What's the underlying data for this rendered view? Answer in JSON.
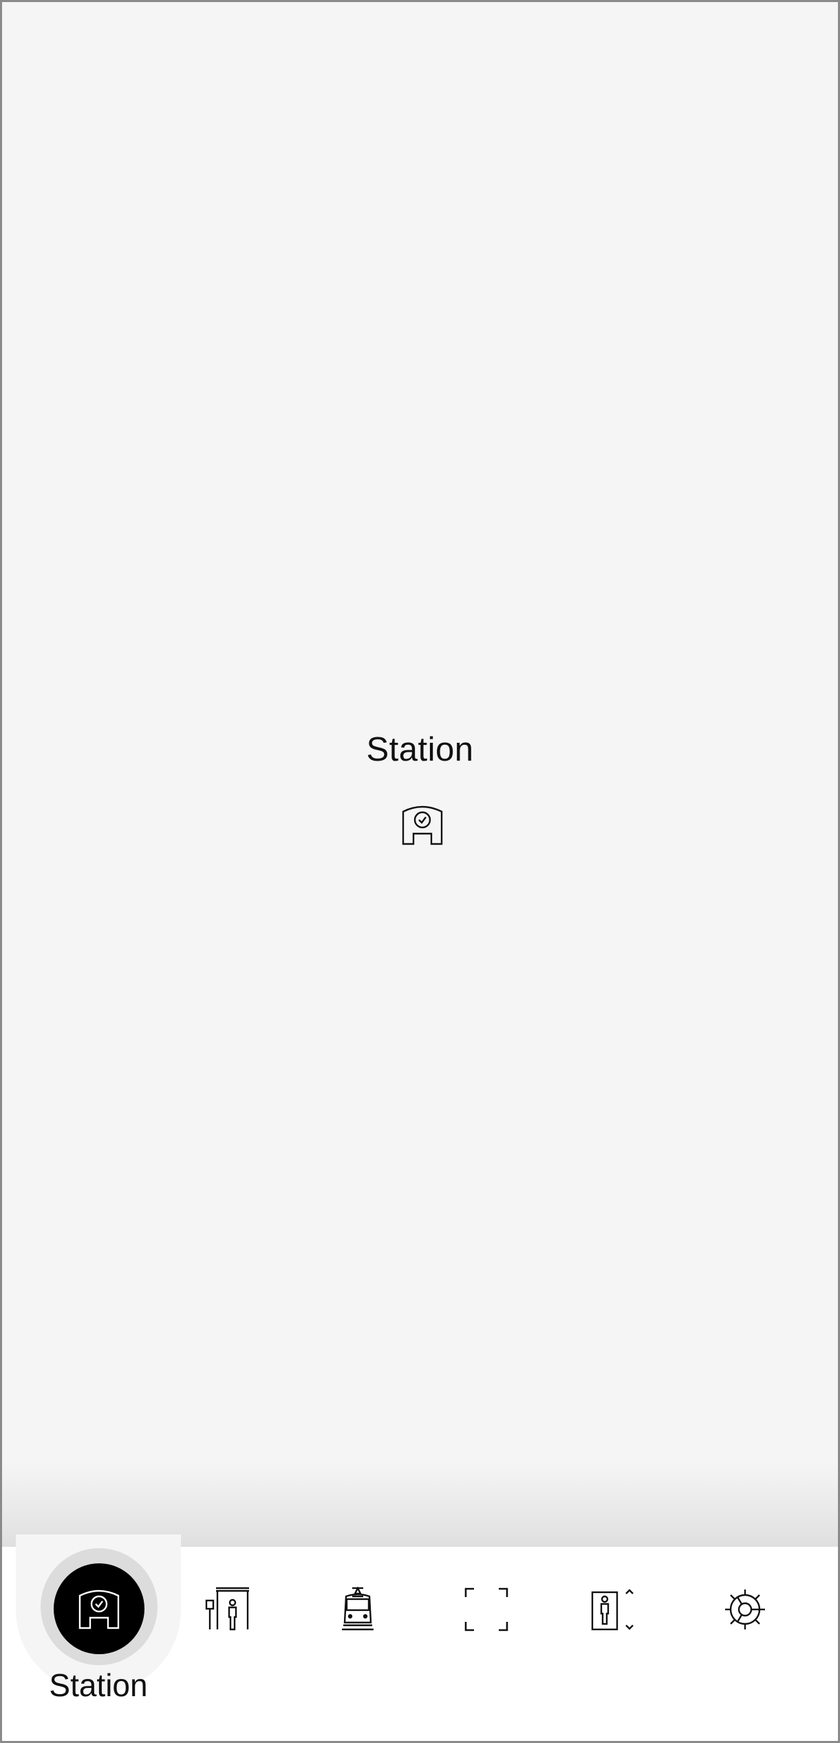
{
  "main": {
    "title": "Station",
    "icon": "station-clock-icon"
  },
  "tabbar": {
    "active_tab": "station",
    "active_label": "Station",
    "tabs": [
      {
        "id": "station",
        "icon": "station-clock-icon"
      },
      {
        "id": "platform",
        "icon": "platform-sign-icon"
      },
      {
        "id": "train",
        "icon": "train-front-icon"
      },
      {
        "id": "scan",
        "icon": "scan-frame-icon"
      },
      {
        "id": "elevator",
        "icon": "elevator-icon"
      },
      {
        "id": "settings",
        "icon": "gear-icon"
      }
    ]
  },
  "colors": {
    "background": "#f5f5f5",
    "tabbar_background": "#ffffff",
    "active_tab_fill": "#000000",
    "text": "#111111"
  }
}
